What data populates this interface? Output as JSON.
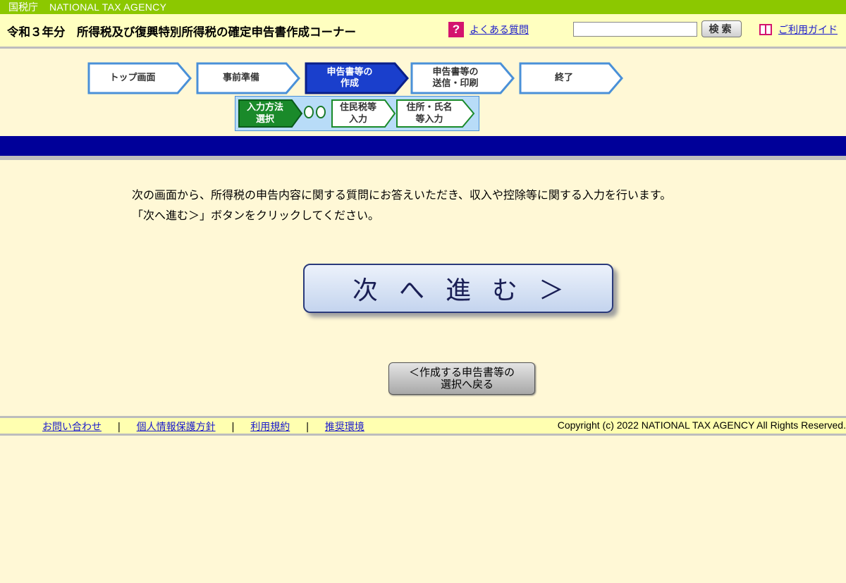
{
  "agency": {
    "jp": "国税庁",
    "en": "NATIONAL TAX AGENCY"
  },
  "header": {
    "title": "令和３年分　所得税及び復興特別所得税の確定申告書作成コーナー",
    "faq_icon": "?",
    "faq_label": "よくある質問",
    "search_placeholder": "",
    "search_value": "",
    "search_button": "検索",
    "guide_label": "ご利用ガイド"
  },
  "steps": [
    {
      "label": "トップ画面",
      "state": "done"
    },
    {
      "label": "事前準備",
      "state": "done"
    },
    {
      "label": "申告書等の\n作成",
      "state": "active"
    },
    {
      "label": "申告書等の\n送信・印刷",
      "state": "todo"
    },
    {
      "label": "終了",
      "state": "todo"
    }
  ],
  "substeps": [
    {
      "label": "入力方法\n選択",
      "state": "active"
    },
    {
      "label": "住民税等\n入力",
      "state": "todo"
    },
    {
      "label": "住所・氏名\n等入力",
      "state": "todo"
    }
  ],
  "main": {
    "line1": "次の画面から、所得税の申告内容に関する質問にお答えいただき、収入や控除等に関する入力を行います。",
    "line2": "「次へ進む＞」ボタンをクリックしてください。",
    "next_button": "次へ進む＞",
    "back_button_line1": "＜作成する申告書等の",
    "back_button_line2": "　選択へ戻る"
  },
  "footer": {
    "links": [
      "お問い合わせ",
      "個人情報保護方針",
      "利用規約",
      "推奨環境"
    ],
    "separator": "|",
    "copyright": "Copyright (c) 2022 NATIONAL TAX AGENCY All Rights Reserved."
  },
  "colors": {
    "agency_bar": "#8cc800",
    "header_bg": "#ffffc0",
    "page_bg": "#fff8d6",
    "band": "#000099",
    "step_active": "#1a3fcc",
    "step_border": "#4a90d8",
    "substep_active": "#1a8a2a"
  }
}
